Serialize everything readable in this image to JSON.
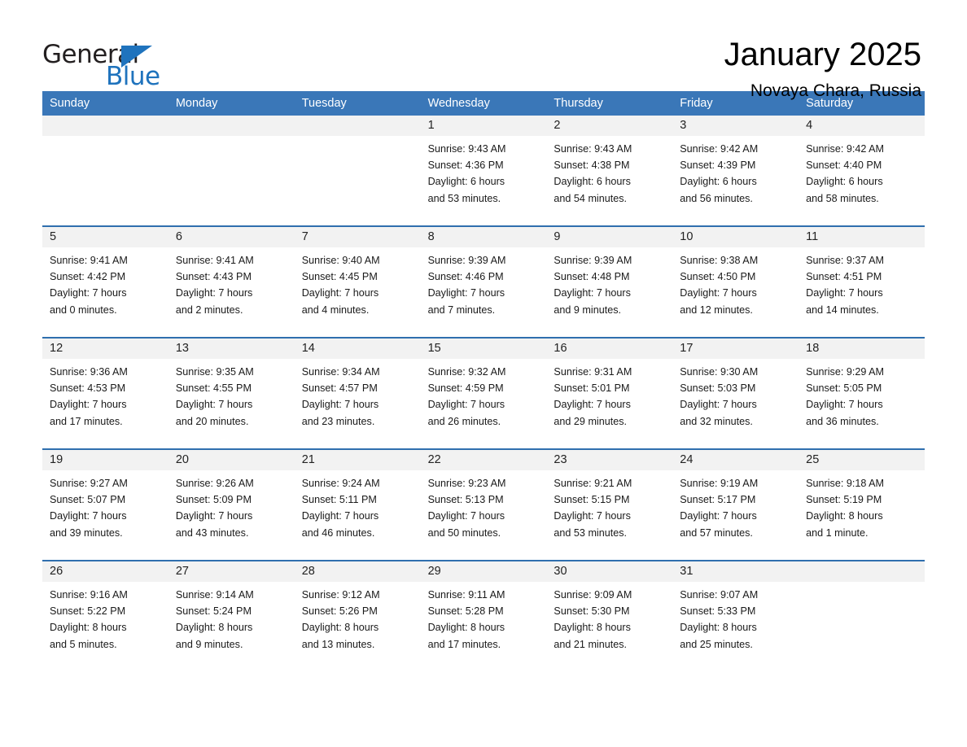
{
  "logo": {
    "word_one": "General",
    "word_two": "Blue",
    "triangle": "triangle-mark",
    "accent_color": "#1f73bd"
  },
  "header": {
    "title": "January 2025",
    "subtitle": "Novaya Chara, Russia"
  },
  "theme": {
    "header_blue": "#3a77b8",
    "row_divider_blue": "#2f6fae",
    "day_band_gray": "#f2f2f2"
  },
  "weekdays": [
    "Sunday",
    "Monday",
    "Tuesday",
    "Wednesday",
    "Thursday",
    "Friday",
    "Saturday"
  ],
  "weeks": [
    [
      {
        "day": "",
        "sunrise": "",
        "sunset": "",
        "daylight_line1": "",
        "daylight_line2": ""
      },
      {
        "day": "",
        "sunrise": "",
        "sunset": "",
        "daylight_line1": "",
        "daylight_line2": ""
      },
      {
        "day": "",
        "sunrise": "",
        "sunset": "",
        "daylight_line1": "",
        "daylight_line2": ""
      },
      {
        "day": "1",
        "sunrise": "Sunrise: 9:43 AM",
        "sunset": "Sunset: 4:36 PM",
        "daylight_line1": "Daylight: 6 hours",
        "daylight_line2": "and 53 minutes."
      },
      {
        "day": "2",
        "sunrise": "Sunrise: 9:43 AM",
        "sunset": "Sunset: 4:38 PM",
        "daylight_line1": "Daylight: 6 hours",
        "daylight_line2": "and 54 minutes."
      },
      {
        "day": "3",
        "sunrise": "Sunrise: 9:42 AM",
        "sunset": "Sunset: 4:39 PM",
        "daylight_line1": "Daylight: 6 hours",
        "daylight_line2": "and 56 minutes."
      },
      {
        "day": "4",
        "sunrise": "Sunrise: 9:42 AM",
        "sunset": "Sunset: 4:40 PM",
        "daylight_line1": "Daylight: 6 hours",
        "daylight_line2": "and 58 minutes."
      }
    ],
    [
      {
        "day": "5",
        "sunrise": "Sunrise: 9:41 AM",
        "sunset": "Sunset: 4:42 PM",
        "daylight_line1": "Daylight: 7 hours",
        "daylight_line2": "and 0 minutes."
      },
      {
        "day": "6",
        "sunrise": "Sunrise: 9:41 AM",
        "sunset": "Sunset: 4:43 PM",
        "daylight_line1": "Daylight: 7 hours",
        "daylight_line2": "and 2 minutes."
      },
      {
        "day": "7",
        "sunrise": "Sunrise: 9:40 AM",
        "sunset": "Sunset: 4:45 PM",
        "daylight_line1": "Daylight: 7 hours",
        "daylight_line2": "and 4 minutes."
      },
      {
        "day": "8",
        "sunrise": "Sunrise: 9:39 AM",
        "sunset": "Sunset: 4:46 PM",
        "daylight_line1": "Daylight: 7 hours",
        "daylight_line2": "and 7 minutes."
      },
      {
        "day": "9",
        "sunrise": "Sunrise: 9:39 AM",
        "sunset": "Sunset: 4:48 PM",
        "daylight_line1": "Daylight: 7 hours",
        "daylight_line2": "and 9 minutes."
      },
      {
        "day": "10",
        "sunrise": "Sunrise: 9:38 AM",
        "sunset": "Sunset: 4:50 PM",
        "daylight_line1": "Daylight: 7 hours",
        "daylight_line2": "and 12 minutes."
      },
      {
        "day": "11",
        "sunrise": "Sunrise: 9:37 AM",
        "sunset": "Sunset: 4:51 PM",
        "daylight_line1": "Daylight: 7 hours",
        "daylight_line2": "and 14 minutes."
      }
    ],
    [
      {
        "day": "12",
        "sunrise": "Sunrise: 9:36 AM",
        "sunset": "Sunset: 4:53 PM",
        "daylight_line1": "Daylight: 7 hours",
        "daylight_line2": "and 17 minutes."
      },
      {
        "day": "13",
        "sunrise": "Sunrise: 9:35 AM",
        "sunset": "Sunset: 4:55 PM",
        "daylight_line1": "Daylight: 7 hours",
        "daylight_line2": "and 20 minutes."
      },
      {
        "day": "14",
        "sunrise": "Sunrise: 9:34 AM",
        "sunset": "Sunset: 4:57 PM",
        "daylight_line1": "Daylight: 7 hours",
        "daylight_line2": "and 23 minutes."
      },
      {
        "day": "15",
        "sunrise": "Sunrise: 9:32 AM",
        "sunset": "Sunset: 4:59 PM",
        "daylight_line1": "Daylight: 7 hours",
        "daylight_line2": "and 26 minutes."
      },
      {
        "day": "16",
        "sunrise": "Sunrise: 9:31 AM",
        "sunset": "Sunset: 5:01 PM",
        "daylight_line1": "Daylight: 7 hours",
        "daylight_line2": "and 29 minutes."
      },
      {
        "day": "17",
        "sunrise": "Sunrise: 9:30 AM",
        "sunset": "Sunset: 5:03 PM",
        "daylight_line1": "Daylight: 7 hours",
        "daylight_line2": "and 32 minutes."
      },
      {
        "day": "18",
        "sunrise": "Sunrise: 9:29 AM",
        "sunset": "Sunset: 5:05 PM",
        "daylight_line1": "Daylight: 7 hours",
        "daylight_line2": "and 36 minutes."
      }
    ],
    [
      {
        "day": "19",
        "sunrise": "Sunrise: 9:27 AM",
        "sunset": "Sunset: 5:07 PM",
        "daylight_line1": "Daylight: 7 hours",
        "daylight_line2": "and 39 minutes."
      },
      {
        "day": "20",
        "sunrise": "Sunrise: 9:26 AM",
        "sunset": "Sunset: 5:09 PM",
        "daylight_line1": "Daylight: 7 hours",
        "daylight_line2": "and 43 minutes."
      },
      {
        "day": "21",
        "sunrise": "Sunrise: 9:24 AM",
        "sunset": "Sunset: 5:11 PM",
        "daylight_line1": "Daylight: 7 hours",
        "daylight_line2": "and 46 minutes."
      },
      {
        "day": "22",
        "sunrise": "Sunrise: 9:23 AM",
        "sunset": "Sunset: 5:13 PM",
        "daylight_line1": "Daylight: 7 hours",
        "daylight_line2": "and 50 minutes."
      },
      {
        "day": "23",
        "sunrise": "Sunrise: 9:21 AM",
        "sunset": "Sunset: 5:15 PM",
        "daylight_line1": "Daylight: 7 hours",
        "daylight_line2": "and 53 minutes."
      },
      {
        "day": "24",
        "sunrise": "Sunrise: 9:19 AM",
        "sunset": "Sunset: 5:17 PM",
        "daylight_line1": "Daylight: 7 hours",
        "daylight_line2": "and 57 minutes."
      },
      {
        "day": "25",
        "sunrise": "Sunrise: 9:18 AM",
        "sunset": "Sunset: 5:19 PM",
        "daylight_line1": "Daylight: 8 hours",
        "daylight_line2": "and 1 minute."
      }
    ],
    [
      {
        "day": "26",
        "sunrise": "Sunrise: 9:16 AM",
        "sunset": "Sunset: 5:22 PM",
        "daylight_line1": "Daylight: 8 hours",
        "daylight_line2": "and 5 minutes."
      },
      {
        "day": "27",
        "sunrise": "Sunrise: 9:14 AM",
        "sunset": "Sunset: 5:24 PM",
        "daylight_line1": "Daylight: 8 hours",
        "daylight_line2": "and 9 minutes."
      },
      {
        "day": "28",
        "sunrise": "Sunrise: 9:12 AM",
        "sunset": "Sunset: 5:26 PM",
        "daylight_line1": "Daylight: 8 hours",
        "daylight_line2": "and 13 minutes."
      },
      {
        "day": "29",
        "sunrise": "Sunrise: 9:11 AM",
        "sunset": "Sunset: 5:28 PM",
        "daylight_line1": "Daylight: 8 hours",
        "daylight_line2": "and 17 minutes."
      },
      {
        "day": "30",
        "sunrise": "Sunrise: 9:09 AM",
        "sunset": "Sunset: 5:30 PM",
        "daylight_line1": "Daylight: 8 hours",
        "daylight_line2": "and 21 minutes."
      },
      {
        "day": "31",
        "sunrise": "Sunrise: 9:07 AM",
        "sunset": "Sunset: 5:33 PM",
        "daylight_line1": "Daylight: 8 hours",
        "daylight_line2": "and 25 minutes."
      },
      {
        "day": "",
        "sunrise": "",
        "sunset": "",
        "daylight_line1": "",
        "daylight_line2": ""
      }
    ]
  ]
}
